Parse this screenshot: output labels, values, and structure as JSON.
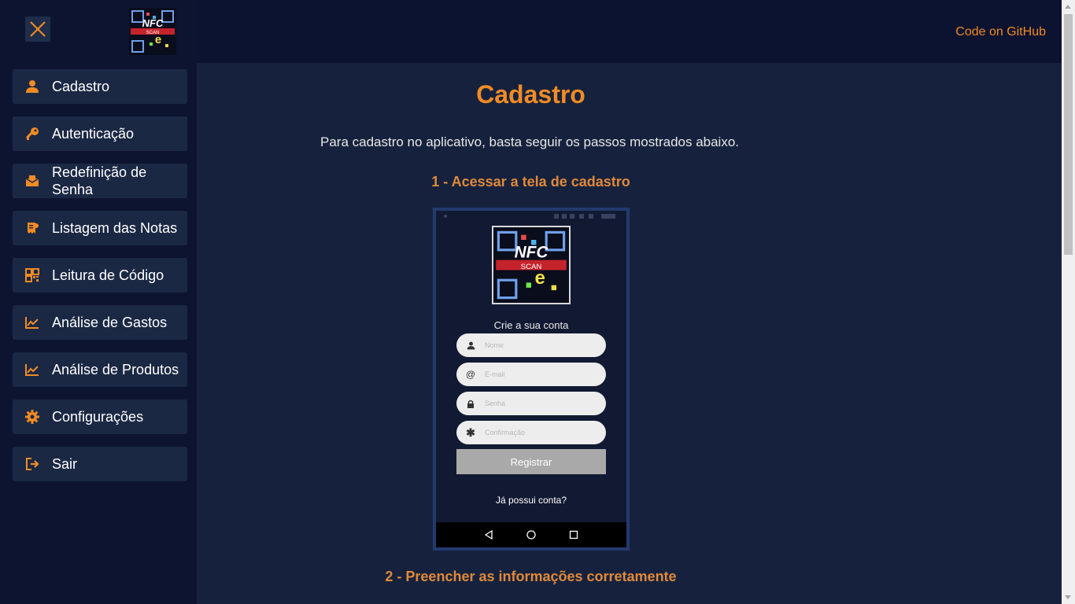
{
  "header": {
    "github_link": "Code on GitHub"
  },
  "logo": {
    "text_top": "NFC",
    "text_mid": "SCAN",
    "text_letter": "e"
  },
  "sidebar": {
    "items": [
      {
        "label": "Cadastro",
        "icon": "user-icon"
      },
      {
        "label": "Autenticação",
        "icon": "key-icon"
      },
      {
        "label": "Redefinição de Senha",
        "icon": "mail-envelope-icon"
      },
      {
        "label": "Listagem das Notas",
        "icon": "receipt-icon"
      },
      {
        "label": "Leitura de Código",
        "icon": "qrcode-icon"
      },
      {
        "label": "Análise de Gastos",
        "icon": "chart-line-icon"
      },
      {
        "label": "Análise de Produtos",
        "icon": "chart-line-icon"
      },
      {
        "label": "Configurações",
        "icon": "gear-icon"
      },
      {
        "label": "Sair",
        "icon": "sign-out-icon"
      }
    ]
  },
  "main": {
    "title": "Cadastro",
    "intro": "Para cadastro no aplicativo, basta seguir os passos mostrados abaixo.",
    "steps": [
      "1 - Acessar a tela de cadastro",
      "2 - Preencher as informações corretamente"
    ]
  },
  "phone": {
    "heading": "Crie a sua conta",
    "fields": [
      {
        "placeholder": "Nome",
        "icon": "user-icon"
      },
      {
        "placeholder": "E-mail",
        "icon": "at-icon"
      },
      {
        "placeholder": "Senha",
        "icon": "lock-icon"
      },
      {
        "placeholder": "Confirmação",
        "icon": "asterisk-icon"
      }
    ],
    "register_button": "Registrar",
    "login_link": "Já possui conta?"
  },
  "colors": {
    "accent": "#f28b24",
    "sidebar_bg": "#0d1430",
    "main_bg": "#16223d",
    "button_bg": "#1b2844"
  }
}
